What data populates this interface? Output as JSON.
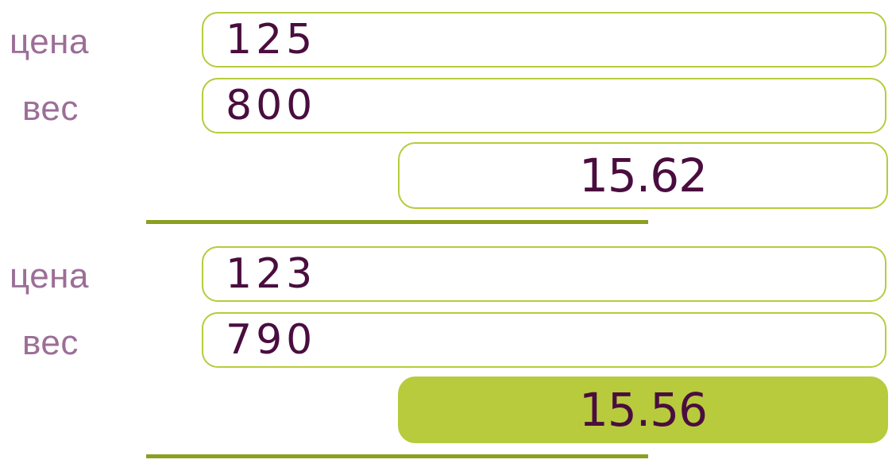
{
  "calc1": {
    "price_label": "цена",
    "price_value": "125",
    "weight_label": "вес",
    "weight_value": "800",
    "result": "15.62"
  },
  "calc2": {
    "price_label": "цена",
    "price_value": "123",
    "weight_label": "вес",
    "weight_value": "790",
    "result": "15.56"
  },
  "colors": {
    "label": "#9b6e97",
    "text": "#4a0d3f",
    "accent": "#b7cb3c",
    "divider": "#8c9f1f"
  }
}
